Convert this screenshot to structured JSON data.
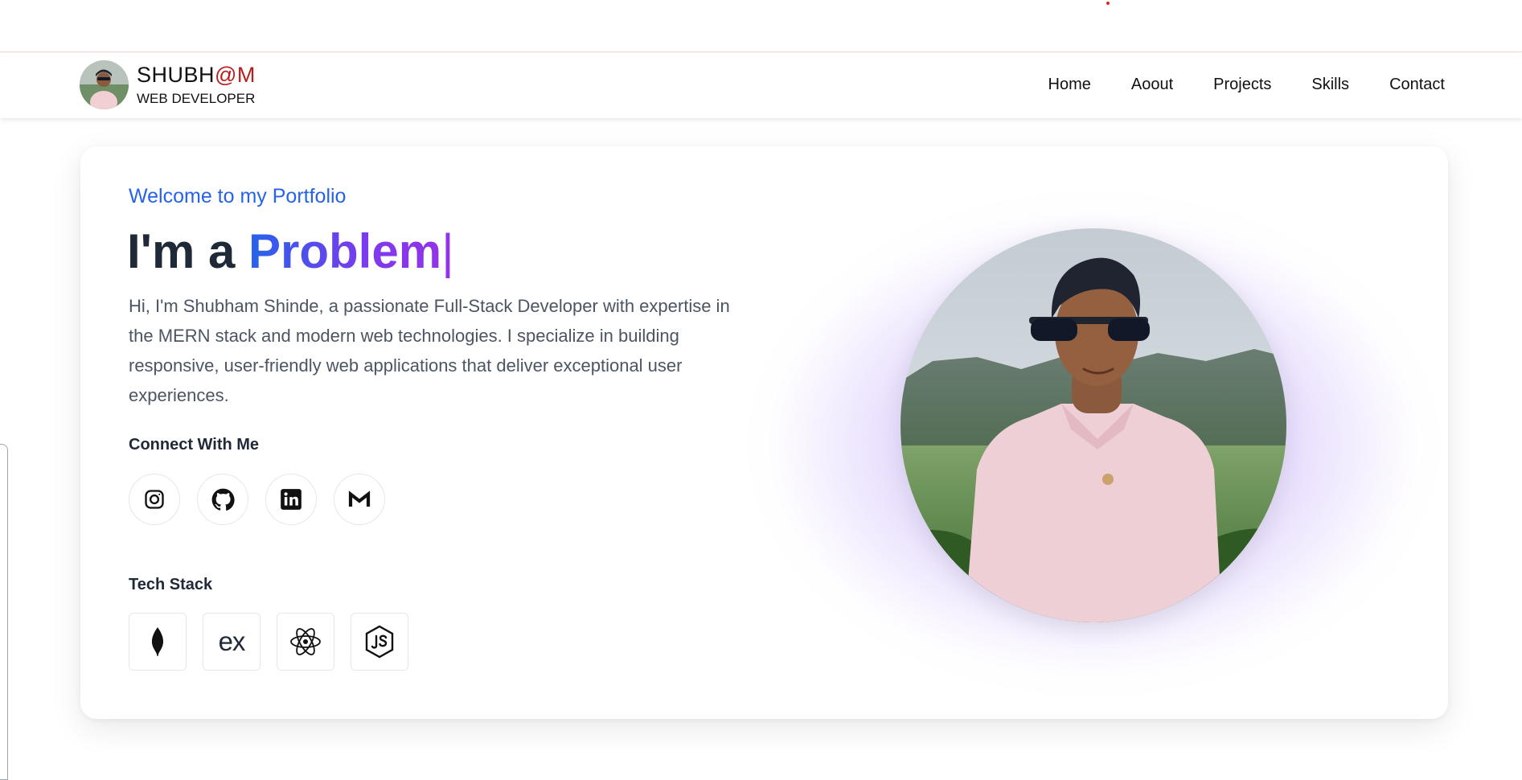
{
  "brand": {
    "name_prefix": "SHUBH",
    "name_accent": "@M",
    "subtitle": "WEB DEVELOPER"
  },
  "nav": {
    "items": [
      "Home",
      "Aoout",
      "Projects",
      "Skills",
      "Contact"
    ]
  },
  "hero": {
    "welcome": "Welcome to my Portfolio",
    "headline_prefix": "I'm a",
    "headline_typed": "Problem",
    "cursor": "|",
    "intro": "Hi, I'm Shubham Shinde, a passionate Full-Stack Developer with expertise in the MERN stack and modern web technologies. I specialize in building responsive, user-friendly web applications that deliver exceptional user experiences.",
    "connect_label": "Connect With Me",
    "tech_label": "Tech Stack"
  },
  "social": [
    "instagram-icon",
    "github-icon",
    "linkedin-icon",
    "gmail-icon"
  ],
  "tech_stack": [
    "mongodb-icon",
    "express-icon",
    "react-icon",
    "nodejs-icon"
  ],
  "tech_text": {
    "express": "ex"
  },
  "colors": {
    "accent_blue": "#2563eb",
    "accent_purple": "#9333ea",
    "brand_red": "#b91c1c"
  }
}
